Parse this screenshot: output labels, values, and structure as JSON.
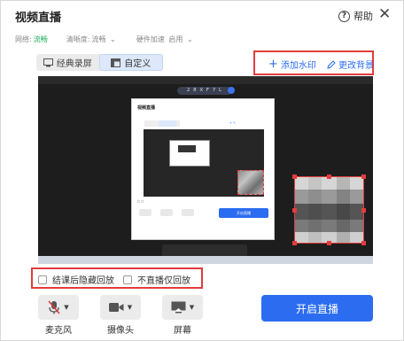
{
  "window": {
    "title": "视频直播",
    "help_label": "帮助"
  },
  "status": {
    "network_label": "网络:",
    "network_value": "流畅",
    "quality_label": "清晰度:",
    "quality_value": "流畅",
    "hwaccel_label": "硬件加速",
    "hwaccel_value": "启用"
  },
  "tabs": [
    {
      "label": "经典录屏",
      "active": false
    },
    {
      "label": "自定义",
      "active": true
    }
  ],
  "actions": {
    "add_watermark": "添加水印",
    "change_background": "更改背景"
  },
  "preview": {
    "room_code": "2 8 X F 7 L"
  },
  "options": [
    {
      "label": "结课后隐藏回放",
      "checked": false
    },
    {
      "label": "不直播仅回放",
      "checked": false
    }
  ],
  "devices": [
    {
      "label": "麦克风",
      "icon": "mic-muted-icon"
    },
    {
      "label": "摄像头",
      "icon": "camera-icon"
    },
    {
      "label": "屏幕",
      "icon": "screen-icon"
    }
  ],
  "start_button": "开启直播",
  "colors": {
    "accent": "#2b6cf0",
    "ok": "#1cae5c",
    "highlight": "#e23c3c"
  }
}
